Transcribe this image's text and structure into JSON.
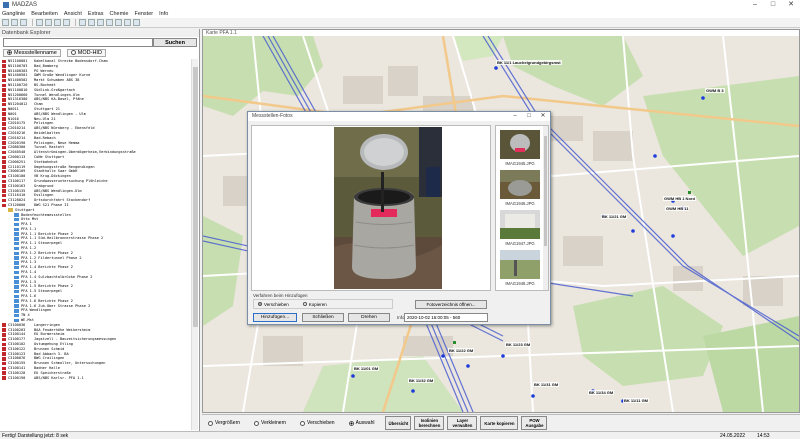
{
  "window": {
    "title": "MADZAS"
  },
  "menu": [
    "Ganglinie",
    "Bearbeiten",
    "Ansicht",
    "Extras",
    "Chemie",
    "Fenster",
    "Info"
  ],
  "left_panel": {
    "title": "Datenbank Explorer",
    "search_placeholder": "",
    "search_button": "Suchen",
    "radio_options": [
      {
        "label": "Messstellenname",
        "selected": true
      },
      {
        "label": "MOD-HID",
        "selected": false
      }
    ],
    "tree": [
      {
        "code": "N51100001",
        "text": "Kabelkanal Strecke Bodensdorf-Cham"
      },
      {
        "code": "N51100703",
        "text": "Bad_Bamberg"
      },
      {
        "code": "N51400303",
        "text": "PG Werneu"
      },
      {
        "code": "N51400501",
        "text": "GWM Große Wendlinger Kurve"
      },
      {
        "code": "N51400502",
        "text": "Markt Schwaben ABS 38"
      },
      {
        "code": "N51100720",
        "text": "BS-Bochedt"
      },
      {
        "code": "N51100810",
        "text": "Südlink-Großgartach"
      },
      {
        "code": "N51200660",
        "text": "Tunnel Wendlingen-Ulm"
      },
      {
        "code": "N51316300",
        "text": "ABS/NBS KA-Basel, Pfähe"
      },
      {
        "code": "N51204012",
        "text": "Cham"
      },
      {
        "code": "N0011",
        "text": "Stuttgart 21"
      },
      {
        "code": "N001",
        "text": "ABS/NBS Wendlingen - Ulm"
      },
      {
        "code": "N1016",
        "text": "Neu-Ulm 21"
      },
      {
        "code": "C2010175",
        "text": "Pelzingen"
      },
      {
        "code": "C2010214",
        "text": "ABS/NBS Nürnberg - Ebensfeld"
      },
      {
        "code": "C2010216",
        "text": "Heidelbalten"
      },
      {
        "code": "C2010214",
        "text": "Bad-Rebach"
      },
      {
        "code": "C2020190",
        "text": "Pelzingen, Neue Hemma"
      },
      {
        "code": "C2080300",
        "text": "Tunnel Rastatt"
      },
      {
        "code": "C2040540",
        "text": "Altenstrümingen-Oberdögerheim,Verbindungsstraße"
      },
      {
        "code": "C2000113",
        "text": "CoNe Stuttgart"
      },
      {
        "code": "C2000251",
        "text": "Stetbahnhot"
      },
      {
        "code": "C2110119",
        "text": "Umgehungsstraße Rengendingen"
      },
      {
        "code": "C3000109",
        "text": "Stadthalle Saar GmbH"
      },
      {
        "code": "C3100100",
        "text": "VB Krug-Döckingen"
      },
      {
        "code": "C3100117",
        "text": "Grundwasseruntersuchung Plöhleiche"
      },
      {
        "code": "C3100163",
        "text": "Grabgrund"
      },
      {
        "code": "C3100135",
        "text": "ABS/NBS Wendlingen-Ulm"
      },
      {
        "code": "C3116410",
        "text": "Esslingen"
      },
      {
        "code": "C3128024",
        "text": "Ortsdurchfahrt Stackendorf"
      },
      {
        "code": "C3120000",
        "text": "DWG S21 Phase II"
      }
    ],
    "folder_root": "Stuttgart",
    "folder_items": [
      "Bodenfeuchtemessstellen",
      "Otto Mst",
      "PFA 1",
      "PFA 1.1",
      "PFA 1.1 Berichte Phase 2",
      "PFA 1.1 Süd-Heilbronnerstrasse Phase 2",
      "PFA 1.1 Steuerpegel",
      "PFA 1.2",
      "PFA 1.2 Berichte Phase 2",
      "PFA 1.2 Fildertunnel Phase 2",
      "PFA 1.3",
      "PFA 1.4 Berichte Phase 2",
      "PFA 1.4",
      "PFA 1.4 Sulzbachtalbrücke Phase 2",
      "PFA 1.5",
      "PFA 1.5 Berichte Phase 2",
      "PFA 1.5 Steuerpegel",
      "PFA 1.6",
      "PFA 1.6 Berichte Phase 2",
      "PFA 1.6 Zuh.Ober Strasse Phase 2",
      "PFA Wendlingen",
      "TN 4",
      "WE-Mst"
    ],
    "tree_tail": [
      {
        "code": "C3100036",
        "text": "Langerringen"
      },
      {
        "code": "C3100203",
        "text": "BAA Feuderhöhe Weikersheim"
      },
      {
        "code": "C3100144",
        "text": "EÜ Burmersheim"
      },
      {
        "code": "C3100177",
        "text": "Jagstzell - Bauzeitsicherungsmessungen"
      },
      {
        "code": "C3100102",
        "text": "Ostumgehung Etling"
      },
      {
        "code": "C3100122",
        "text": "Brunnen Schmid"
      },
      {
        "code": "C3100123",
        "text": "Bad Abbach 3. BA"
      },
      {
        "code": "C3100076",
        "text": "BWG Crailingen"
      },
      {
        "code": "C3100155",
        "text": "Brunnen Schmoller, Untersuchungen"
      },
      {
        "code": "C3100141",
        "text": "Badner Halle"
      },
      {
        "code": "C3100128",
        "text": "EÜ Speicherstraße"
      },
      {
        "code": "C3100190",
        "text": "ABS/NBS Karlsr. PFA 1.1"
      }
    ]
  },
  "map": {
    "title": "Karte PFA 1.1",
    "labels": [
      {
        "text": "BK 11/1 Lauchelgrundgebirgsmst"
      },
      {
        "text": "GWM B 3"
      },
      {
        "text": "GWM HB 1 Nord"
      },
      {
        "text": "GWM HB 11"
      },
      {
        "text": "BK 11/21 GM"
      },
      {
        "text": "BK 11/22 GM"
      },
      {
        "text": "BK 11/23 GM"
      },
      {
        "text": "BK 11/32 GM"
      },
      {
        "text": "BK 11/31 GM"
      },
      {
        "text": "BK 11/34 GM"
      },
      {
        "text": "BK 11/01 GM"
      },
      {
        "text": "BK 11/11 GM"
      }
    ]
  },
  "dialog": {
    "title": "Messstellen-Fotos",
    "thumbnails": [
      "IMAG1945.JPG",
      "IMAG1946.JPG",
      "IMAG1947.JPG",
      "IMAG1948.JPG"
    ],
    "mode_label": "Verfahren beim Hinzufügen",
    "mode_options": [
      {
        "label": "Verschieben",
        "selected": true
      },
      {
        "label": "Kopieren",
        "selected": false
      }
    ],
    "open_dir_button": "Fotoverzeichnis öffnen...",
    "add_button": "Hinzufügen...",
    "close_button": "Schließen",
    "rotate_button": "Drehen",
    "date_label": "Info",
    "date_value": "2020-10-02 16:00:05 - 560"
  },
  "bottom_toolbar": {
    "radios": [
      {
        "label": "Vergrößern",
        "selected": false
      },
      {
        "label": "Verkleinern",
        "selected": false
      },
      {
        "label": "Verschieben",
        "selected": false
      },
      {
        "label": "Auswahl",
        "selected": true
      }
    ],
    "buttons": [
      {
        "line1": "Übersicht",
        "line2": ""
      },
      {
        "line1": "Isolinien",
        "line2": "berechnen"
      },
      {
        "line1": "Layer",
        "line2": "verwalten"
      },
      {
        "line1": "Karte kopieren",
        "line2": ""
      },
      {
        "line1": "POW",
        "line2": "Ausgabe"
      }
    ]
  },
  "status": {
    "message": "Fertig! Darstellung jetzt: 8 sek",
    "date": "24.05.2022",
    "time": "14:53"
  },
  "colors": {
    "code_red": "#c0282c",
    "folder": "#d9b64a",
    "map_green": "#c7dfb0",
    "rail_blue": "#4a5ed0",
    "point_blue": "#1e3cd8"
  }
}
